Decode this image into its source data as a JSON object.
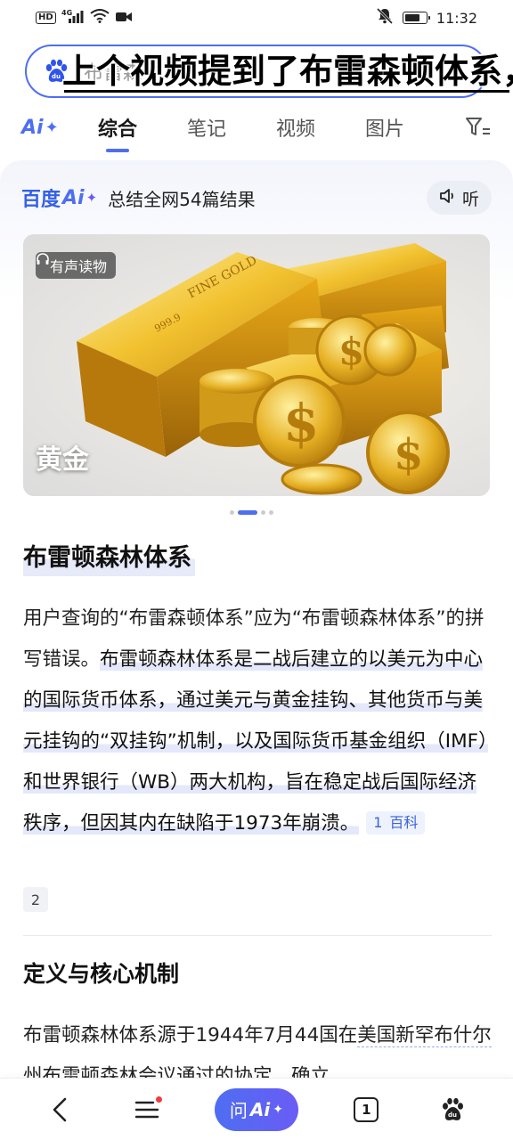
{
  "status_bar": {
    "network_badge": "HD",
    "signal_label": "4G",
    "time": "11:32"
  },
  "search": {
    "query": "布雷森",
    "caption_overlay": "上个视频提到了布雷森顿体系，"
  },
  "tabs": {
    "ai_label": "Ai",
    "items": [
      "综合",
      "笔记",
      "视频",
      "图片"
    ],
    "active": "综合"
  },
  "ai_header": {
    "logo_text": "百度",
    "logo_ai": "Ai",
    "summary": "总结全网54篇结果",
    "listen_label": "听"
  },
  "hero": {
    "badge": "有声读物",
    "caption": "黄金",
    "bar_text_1": "FINE GOLD",
    "bar_text_2": "999.9"
  },
  "article": {
    "title": "布雷顿森林体系",
    "para_plain": "用户查询的“布雷森顿体系”应为“布雷顿森林体系”的拼写错误。",
    "para_highlight": "布雷顿森林体系是二战后建立的以美元为中心的国际货币体系，通过美元与黄金挂钩、其他货币与美元挂钩的“双挂钩”机制，以及国际货币基金组织（IMF）和世界银行（WB）两大机构，旨在稳定战后国际经济秩序，但因其内在缺陷于1973年崩溃。",
    "ref1_num": "1",
    "ref1_label": "百科",
    "ref2_num": "2",
    "section_title": "定义与核心机制",
    "section_para_a": "布雷顿森林体系源于1944年7月44国在",
    "section_para_link": "美国新罕布什尔州",
    "section_para_b": "布雷顿森林会议通过的协定，确立"
  },
  "bottom_nav": {
    "ask_label": "问",
    "ask_ai": "Ai",
    "tab_count": "1"
  },
  "colors": {
    "accent": "#4e6ef2",
    "highlight": "#e4e8fa",
    "notification": "#f03c3c"
  }
}
